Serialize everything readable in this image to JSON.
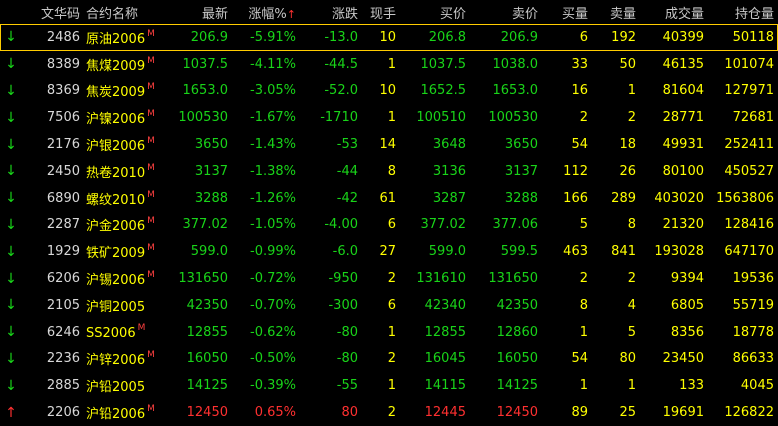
{
  "header": {
    "code": "文华码",
    "name": "合约名称",
    "last": "最新",
    "pct": "涨幅%",
    "pct_sort": "↑",
    "chg": "涨跌",
    "hand": "现手",
    "bid": "买价",
    "ask": "卖价",
    "bidvol": "买量",
    "askvol": "卖量",
    "volume": "成交量",
    "oi": "持仓量"
  },
  "rows": [
    {
      "dir": "down",
      "arrow": "↓",
      "code": "2486",
      "name": "原油2006",
      "mark": "M",
      "last": "206.9",
      "pct": "-5.91%",
      "chg": "-13.0",
      "hand": "10",
      "bid": "206.8",
      "ask": "206.9",
      "bidvol": "6",
      "askvol": "192",
      "volume": "40399",
      "oi": "50118"
    },
    {
      "dir": "down",
      "arrow": "↓",
      "code": "8389",
      "name": "焦煤2009",
      "mark": "M",
      "last": "1037.5",
      "pct": "-4.11%",
      "chg": "-44.5",
      "hand": "1",
      "bid": "1037.5",
      "ask": "1038.0",
      "bidvol": "33",
      "askvol": "50",
      "volume": "46135",
      "oi": "101074"
    },
    {
      "dir": "down",
      "arrow": "↓",
      "code": "8369",
      "name": "焦炭2009",
      "mark": "M",
      "last": "1653.0",
      "pct": "-3.05%",
      "chg": "-52.0",
      "hand": "10",
      "bid": "1652.5",
      "ask": "1653.0",
      "bidvol": "16",
      "askvol": "1",
      "volume": "81604",
      "oi": "127971"
    },
    {
      "dir": "down",
      "arrow": "↓",
      "code": "7506",
      "name": "沪镍2006",
      "mark": "M",
      "last": "100530",
      "pct": "-1.67%",
      "chg": "-1710",
      "hand": "1",
      "bid": "100510",
      "ask": "100530",
      "bidvol": "2",
      "askvol": "2",
      "volume": "28771",
      "oi": "72681"
    },
    {
      "dir": "down",
      "arrow": "↓",
      "code": "2176",
      "name": "沪银2006",
      "mark": "M",
      "last": "3650",
      "pct": "-1.43%",
      "chg": "-53",
      "hand": "14",
      "bid": "3648",
      "ask": "3650",
      "bidvol": "54",
      "askvol": "18",
      "volume": "49931",
      "oi": "252411"
    },
    {
      "dir": "down",
      "arrow": "↓",
      "code": "2450",
      "name": "热卷2010",
      "mark": "M",
      "last": "3137",
      "pct": "-1.38%",
      "chg": "-44",
      "hand": "8",
      "bid": "3136",
      "ask": "3137",
      "bidvol": "112",
      "askvol": "26",
      "volume": "80100",
      "oi": "450527"
    },
    {
      "dir": "down",
      "arrow": "↓",
      "code": "6890",
      "name": "螺纹2010",
      "mark": "M",
      "last": "3288",
      "pct": "-1.26%",
      "chg": "-42",
      "hand": "61",
      "bid": "3287",
      "ask": "3288",
      "bidvol": "166",
      "askvol": "289",
      "volume": "403020",
      "oi": "1563806"
    },
    {
      "dir": "down",
      "arrow": "↓",
      "code": "2287",
      "name": "沪金2006",
      "mark": "M",
      "last": "377.02",
      "pct": "-1.05%",
      "chg": "-4.00",
      "hand": "6",
      "bid": "377.02",
      "ask": "377.06",
      "bidvol": "5",
      "askvol": "8",
      "volume": "21320",
      "oi": "128416"
    },
    {
      "dir": "down",
      "arrow": "↓",
      "code": "1929",
      "name": "铁矿2009",
      "mark": "M",
      "last": "599.0",
      "pct": "-0.99%",
      "chg": "-6.0",
      "hand": "27",
      "bid": "599.0",
      "ask": "599.5",
      "bidvol": "463",
      "askvol": "841",
      "volume": "193028",
      "oi": "647170"
    },
    {
      "dir": "down",
      "arrow": "↓",
      "code": "6206",
      "name": "沪锡2006",
      "mark": "M",
      "last": "131650",
      "pct": "-0.72%",
      "chg": "-950",
      "hand": "2",
      "bid": "131610",
      "ask": "131650",
      "bidvol": "2",
      "askvol": "2",
      "volume": "9394",
      "oi": "19536"
    },
    {
      "dir": "down",
      "arrow": "↓",
      "code": "2105",
      "name": "沪铜2005",
      "mark": "",
      "last": "42350",
      "pct": "-0.70%",
      "chg": "-300",
      "hand": "6",
      "bid": "42340",
      "ask": "42350",
      "bidvol": "8",
      "askvol": "4",
      "volume": "6805",
      "oi": "55719"
    },
    {
      "dir": "down",
      "arrow": "↓",
      "code": "6246",
      "name": "SS2006",
      "mark": "M",
      "last": "12855",
      "pct": "-0.62%",
      "chg": "-80",
      "hand": "1",
      "bid": "12855",
      "ask": "12860",
      "bidvol": "1",
      "askvol": "5",
      "volume": "8356",
      "oi": "18778"
    },
    {
      "dir": "down",
      "arrow": "↓",
      "code": "2236",
      "name": "沪锌2006",
      "mark": "M",
      "last": "16050",
      "pct": "-0.50%",
      "chg": "-80",
      "hand": "2",
      "bid": "16045",
      "ask": "16050",
      "bidvol": "54",
      "askvol": "80",
      "volume": "23450",
      "oi": "86633"
    },
    {
      "dir": "down",
      "arrow": "↓",
      "code": "2885",
      "name": "沪铅2005",
      "mark": "",
      "last": "14125",
      "pct": "-0.39%",
      "chg": "-55",
      "hand": "1",
      "bid": "14115",
      "ask": "14125",
      "bidvol": "1",
      "askvol": "1",
      "volume": "133",
      "oi": "4045"
    },
    {
      "dir": "up",
      "arrow": "↑",
      "code": "2206",
      "name": "沪铅2006",
      "mark": "M",
      "last": "12450",
      "pct": "0.65%",
      "chg": "80",
      "hand": "2",
      "bid": "12445",
      "ask": "12450",
      "bidvol": "89",
      "askvol": "25",
      "volume": "19691",
      "oi": "126822"
    }
  ],
  "colors": {
    "up": "#ff3030",
    "down": "#19d419",
    "name": "#ffff00",
    "selected_border": "#ffcc00",
    "background": "#000000"
  }
}
